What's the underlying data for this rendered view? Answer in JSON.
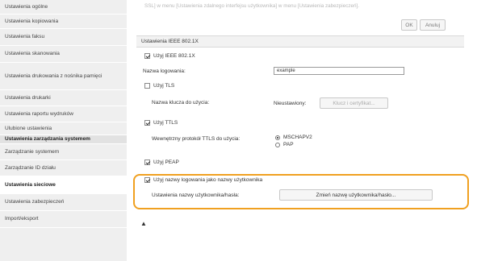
{
  "sidebar": {
    "items": [
      {
        "label": "Ustawienia ogólne",
        "type": "item"
      },
      {
        "label": "Ustawienia kopiowania",
        "type": "item"
      },
      {
        "label": "Ustawienia faksu",
        "type": "item"
      },
      {
        "label": "Ustawienia skanowania",
        "type": "item"
      },
      {
        "label": "Ustawienia drukowania z nośnika pamięci",
        "type": "item"
      },
      {
        "label": "Ustawienia drukarki",
        "type": "item"
      },
      {
        "label": "Ustawienia raportu wydruków",
        "type": "item"
      },
      {
        "label": "Ulubione ustawienia",
        "type": "item"
      },
      {
        "label": "Ustawienia zarządzania systemem",
        "type": "header"
      },
      {
        "label": "Zarządzanie systemem",
        "type": "item"
      },
      {
        "label": "Zarządzanie ID działu",
        "type": "item"
      },
      {
        "label": "Ustawienia sieciowe",
        "type": "active"
      },
      {
        "label": "Ustawienia zabezpieczeń",
        "type": "item"
      },
      {
        "label": "Import/eksport",
        "type": "item"
      }
    ]
  },
  "main": {
    "top_note": "SSL] w menu [Ustawienia zdalnego interfejsu użytkownika] w menu [Ustawienia zabezpieczeń].",
    "ok_label": "OK",
    "cancel_label": "Anuluj",
    "panel_title": "Ustawienia IEEE 802.1X",
    "use_ieee_label": "Użyj IEEE 802.1X",
    "login_name_label": "Nazwa logowania:",
    "login_name_value": "example",
    "use_tls_label": "Użyj TLS",
    "key_name_label": "Nazwa klucza do użycia:",
    "key_name_value": "Nieustawiony:",
    "key_cert_button": "Klucz i certyfikat...",
    "use_ttls_label": "Użyj TTLS",
    "ttls_protocol_label": "Wewnętrzny protokół TTLS do użycia:",
    "radio_mschapv2": "MSCHAPV2",
    "radio_pap": "PAP",
    "use_peap_label": "Użyj PEAP",
    "use_login_as_user_label": "Użyj nazwy logowania jako nazwy użytkownika",
    "user_settings_label": "Ustawienia nazwy użytkownika/hasła:",
    "change_user_button": "Zmień nazwę użytkownika/hasło...",
    "to_top_glyph": "▲"
  }
}
